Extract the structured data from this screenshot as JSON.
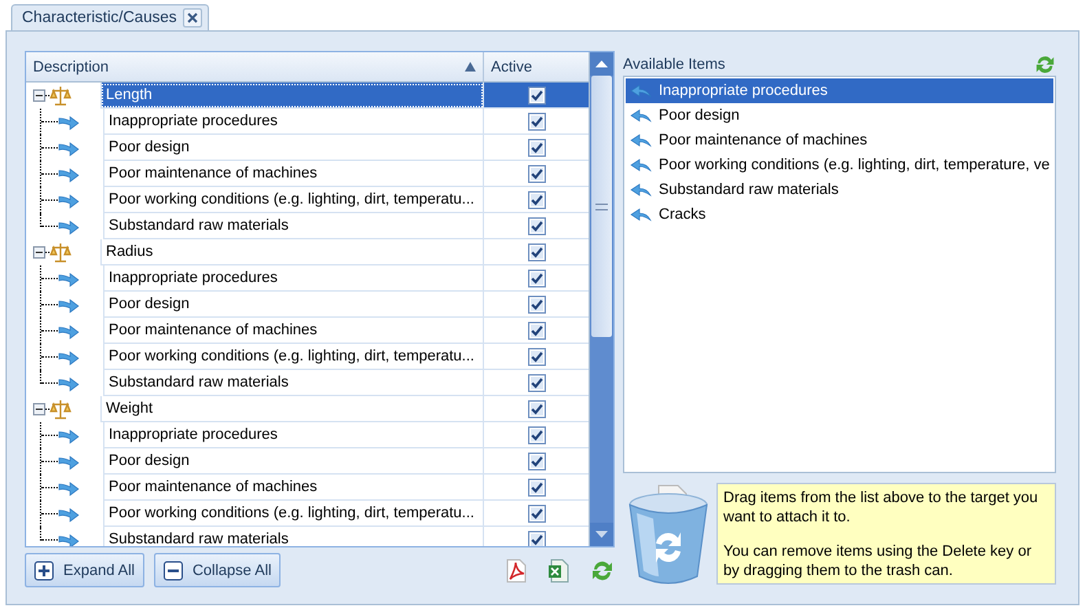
{
  "tab": {
    "label": "Characteristic/Causes",
    "closable": true
  },
  "grid": {
    "columns": [
      {
        "label": "Description",
        "sorted": true
      },
      {
        "label": "Active",
        "sorted": false
      }
    ],
    "rows": [
      {
        "label": "Length",
        "active": true,
        "selected": true,
        "expanded": true,
        "children": [
          {
            "label": "Inappropriate procedures",
            "active": true,
            "selected": false
          },
          {
            "label": "Poor design",
            "active": true,
            "selected": false
          },
          {
            "label": "Poor maintenance of machines",
            "active": true,
            "selected": false
          },
          {
            "label": "Poor working conditions (e.g. lighting, dirt, temperatu...",
            "active": true,
            "selected": false
          },
          {
            "label": "Substandard raw materials",
            "active": true,
            "selected": false
          }
        ]
      },
      {
        "label": "Radius",
        "active": true,
        "selected": false,
        "expanded": true,
        "children": [
          {
            "label": "Inappropriate procedures",
            "active": true,
            "selected": false
          },
          {
            "label": "Poor design",
            "active": true,
            "selected": false
          },
          {
            "label": "Poor maintenance of machines",
            "active": true,
            "selected": false
          },
          {
            "label": "Poor working conditions (e.g. lighting, dirt, temperatu...",
            "active": true,
            "selected": false
          },
          {
            "label": "Substandard raw materials",
            "active": true,
            "selected": false
          }
        ]
      },
      {
        "label": "Weight",
        "active": true,
        "selected": false,
        "expanded": true,
        "children": [
          {
            "label": "Inappropriate procedures",
            "active": true,
            "selected": false
          },
          {
            "label": "Poor design",
            "active": true,
            "selected": false
          },
          {
            "label": "Poor maintenance of machines",
            "active": true,
            "selected": false
          },
          {
            "label": "Poor working conditions (e.g. lighting, dirt, temperatu...",
            "active": true,
            "selected": false
          },
          {
            "label": "Substandard raw materials",
            "active": true,
            "selected": false
          }
        ]
      }
    ]
  },
  "buttons": [
    {
      "label": "Expand All",
      "kind": "expand"
    },
    {
      "label": "Collapse All",
      "kind": "collapse"
    }
  ],
  "available": {
    "title": "Available Items",
    "items": [
      {
        "label": "Inappropriate procedures",
        "selected": true
      },
      {
        "label": "Poor design",
        "selected": false
      },
      {
        "label": "Poor maintenance of machines",
        "selected": false
      },
      {
        "label": "Poor working conditions (e.g. lighting, dirt, temperature, ve",
        "selected": false
      },
      {
        "label": "Substandard raw materials",
        "selected": false
      },
      {
        "label": "Cracks",
        "selected": false
      }
    ]
  },
  "hint": [
    "Drag items from the list above to the target you want to attach it to.",
    "You can remove items using the Delete key or by dragging them to the trash can."
  ]
}
